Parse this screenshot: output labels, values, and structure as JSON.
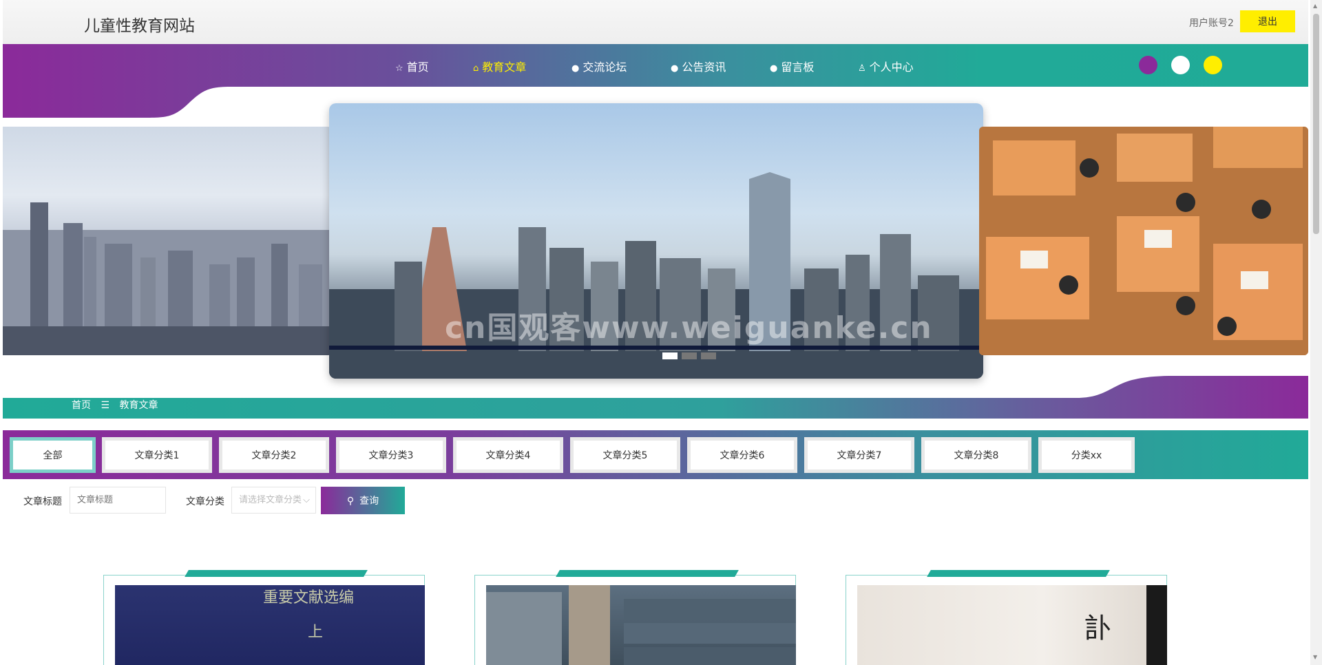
{
  "header": {
    "site_title": "儿童性教育网站",
    "user_account": "用户账号2",
    "logout_label": "退出"
  },
  "nav": {
    "items": [
      {
        "label": "首页",
        "icon": "star-icon"
      },
      {
        "label": "教育文章",
        "icon": "bag-icon",
        "active": true
      },
      {
        "label": "交流论坛",
        "icon": "info-icon"
      },
      {
        "label": "公告资讯",
        "icon": "help-icon"
      },
      {
        "label": "留言板",
        "icon": "info-icon"
      },
      {
        "label": "个人中心",
        "icon": "user-icon"
      }
    ],
    "theme_colors": [
      "#8b2a9a",
      "#ffffff",
      "#ffee00"
    ]
  },
  "carousel": {
    "watermark": "cn国观客www.weiguanke.cn",
    "slide_count": 3,
    "active_index": 0
  },
  "breadcrumb": {
    "home": "首页",
    "separator": "☰",
    "current": "教育文章"
  },
  "categories": {
    "tabs": [
      "全部",
      "文章分类1",
      "文章分类2",
      "文章分类3",
      "文章分类4",
      "文章分类5",
      "文章分类6",
      "文章分类7",
      "文章分类8",
      "分类xx"
    ],
    "active_index": 0
  },
  "search": {
    "title_label": "文章标题",
    "title_placeholder": "文章标题",
    "category_label": "文章分类",
    "category_placeholder": "请选择文章分类",
    "query_label": "查询"
  },
  "articles": {
    "card1_text_top": "重要文献选编",
    "card1_text_mid": "上",
    "card3_text": "訃"
  },
  "colors": {
    "purple": "#8b2a9a",
    "teal": "#21aa98",
    "yellow": "#ffee00"
  }
}
